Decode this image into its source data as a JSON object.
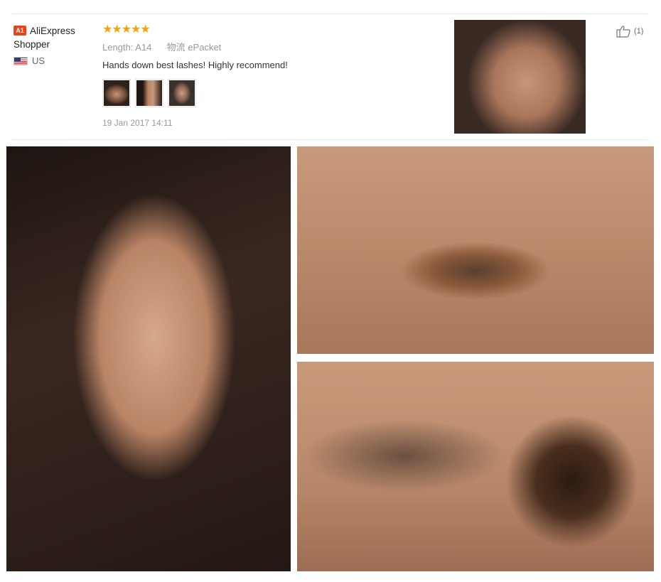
{
  "review": {
    "badge": "A1",
    "reviewer_name": "AliExpress Shopper",
    "country": "US",
    "stars": "★★★★★",
    "rating": 5,
    "length_label": "Length:",
    "length_value": "A14",
    "shipping_label": "物流",
    "shipping_value": "ePacket",
    "text": "Hands down best lashes! Highly recommend!",
    "date": "19 Jan 2017 14:11",
    "helpful_count": "(1)"
  },
  "colors": {
    "star": "#f7a400",
    "badge": "#e8431b"
  }
}
